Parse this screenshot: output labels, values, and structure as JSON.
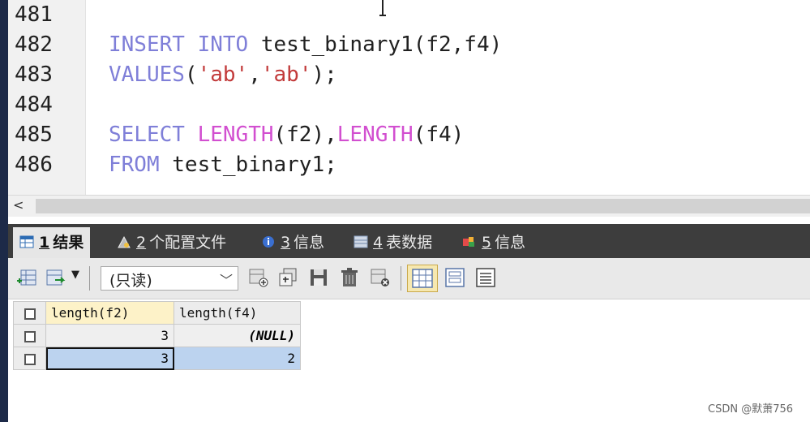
{
  "editor": {
    "lines": [
      {
        "num": "481",
        "tokens": []
      },
      {
        "num": "482",
        "tokens": [
          {
            "t": "INSERT",
            "c": "kw"
          },
          {
            "t": " ",
            "c": ""
          },
          {
            "t": "INTO",
            "c": "kw"
          },
          {
            "t": " test_binary1(f2,f4)",
            "c": ""
          }
        ]
      },
      {
        "num": "483",
        "tokens": [
          {
            "t": "VALUES",
            "c": "kw"
          },
          {
            "t": "(",
            "c": ""
          },
          {
            "t": "'ab'",
            "c": "str"
          },
          {
            "t": ",",
            "c": ""
          },
          {
            "t": "'ab'",
            "c": "str"
          },
          {
            "t": ");",
            "c": ""
          }
        ]
      },
      {
        "num": "484",
        "tokens": []
      },
      {
        "num": "485",
        "tokens": [
          {
            "t": "SELECT",
            "c": "kw"
          },
          {
            "t": " ",
            "c": ""
          },
          {
            "t": "LENGTH",
            "c": "fn"
          },
          {
            "t": "(f2),",
            "c": ""
          },
          {
            "t": "LENGTH",
            "c": "fn"
          },
          {
            "t": "(f4)",
            "c": ""
          }
        ]
      },
      {
        "num": "486",
        "tokens": [
          {
            "t": "FROM",
            "c": "kw"
          },
          {
            "t": " test_binary1;",
            "c": ""
          }
        ]
      }
    ]
  },
  "scrollbar": {
    "left_arrow": "<"
  },
  "tabs": [
    {
      "num": "1",
      "label": "结果",
      "icon": "result-grid-icon"
    },
    {
      "num": "2",
      "label": "个配置文件",
      "icon": "profile-icon"
    },
    {
      "num": "3",
      "label": "信息",
      "icon": "info-icon"
    },
    {
      "num": "4",
      "label": "表数据",
      "icon": "table-data-icon"
    },
    {
      "num": "5",
      "label": "信息",
      "icon": "info-color-icon"
    }
  ],
  "toolbar": {
    "mode_select": "(只读)"
  },
  "grid": {
    "columns": [
      "length(f2)",
      "length(f4)"
    ],
    "rows": [
      [
        "3",
        "(NULL)"
      ],
      [
        "3",
        "2"
      ]
    ]
  },
  "watermark": "CSDN @默萧756",
  "colors": {
    "keyword": "#7f7fd8",
    "function": "#d24fd0",
    "string": "#c23a3a",
    "tab_bar": "#3d3d3d",
    "selected_row": "#bcd3ef"
  }
}
